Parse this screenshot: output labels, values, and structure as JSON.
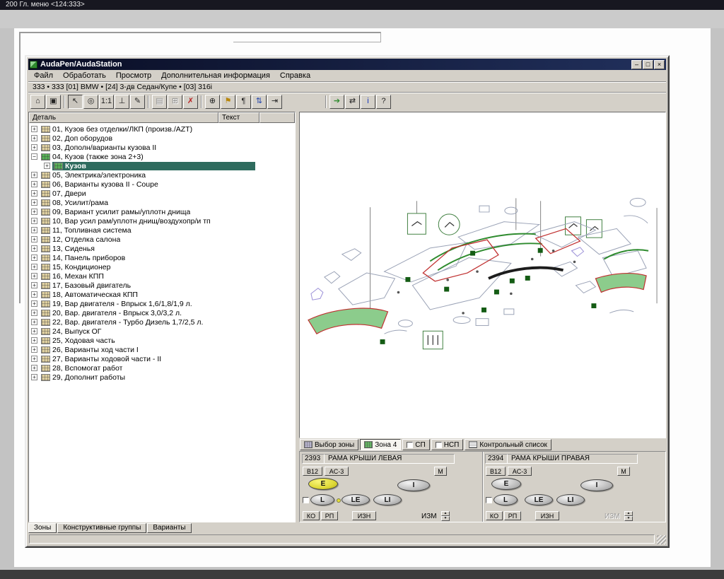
{
  "system": {
    "top_bar_text": "200 Гл. меню  <124:333>"
  },
  "window": {
    "title": "AudaPen/AudaStation",
    "controls": {
      "minimize": "–",
      "maximize": "□",
      "close": "×"
    }
  },
  "menu_bar": {
    "items": [
      "Файл",
      "Обработать",
      "Просмотр",
      "Дополнительная информация",
      "Справка"
    ]
  },
  "path_bar": {
    "text": "333 • 333    [01] BMW  •  [24] 3-дв Седан/Купе  •  [03] 316i"
  },
  "toolbar": {
    "groups": [
      {
        "buttons": [
          {
            "name": "home",
            "glyph": "⌂"
          },
          {
            "name": "workstation",
            "glyph": "▣"
          }
        ]
      },
      {
        "buttons": [
          {
            "name": "select-cursor",
            "glyph": "↖",
            "pressed": true
          },
          {
            "name": "zoom",
            "glyph": "◎"
          },
          {
            "name": "actual-size",
            "glyph": "1:1"
          },
          {
            "name": "measure",
            "glyph": "⊥"
          },
          {
            "name": "draw",
            "glyph": "✎"
          }
        ]
      },
      {
        "buttons": [
          {
            "name": "print",
            "glyph": "▤",
            "disabled": true
          },
          {
            "name": "copy",
            "glyph": "⊞",
            "disabled": true
          },
          {
            "name": "delete",
            "glyph": "✗",
            "color": "#bb2222"
          }
        ]
      },
      {
        "buttons": [
          {
            "name": "zoom-page",
            "glyph": "⊕"
          },
          {
            "name": "flag",
            "glyph": "⚑",
            "color": "#b8860b"
          },
          {
            "name": "pilcrow",
            "glyph": "¶"
          },
          {
            "name": "sort",
            "glyph": "⇅",
            "color": "#2244aa"
          },
          {
            "name": "jump",
            "glyph": "⇥"
          }
        ]
      },
      {
        "gap": true,
        "buttons": [
          {
            "name": "exit",
            "glyph": "➔",
            "color": "#2e8b2e"
          },
          {
            "name": "transfer",
            "glyph": "⇄"
          },
          {
            "name": "info",
            "glyph": "i",
            "color": "#1133bb"
          },
          {
            "name": "help",
            "glyph": "?"
          }
        ]
      }
    ]
  },
  "tree_panel": {
    "columns": [
      {
        "label": "Деталь"
      },
      {
        "label": "Текст"
      }
    ],
    "items": [
      {
        "glyph": "+",
        "icon": "group",
        "label": "01, Кузов без отделки/ЛКП (произв./AZT)"
      },
      {
        "glyph": "+",
        "icon": "group",
        "label": "02, Доп оборудов"
      },
      {
        "glyph": "+",
        "icon": "group",
        "label": "03, Дополн/варианты кузова II"
      },
      {
        "glyph": "−",
        "icon": "zone",
        "label": "04, Кузов (также зона 2+3)"
      },
      {
        "glyph": "+",
        "icon": "zone",
        "label": "Кузов",
        "child": true,
        "selected": true
      },
      {
        "glyph": "+",
        "icon": "group",
        "label": "05, Электрика/электроника"
      },
      {
        "glyph": "+",
        "icon": "group",
        "label": "06, Варианты кузова II - Coupe"
      },
      {
        "glyph": "+",
        "icon": "group",
        "label": "07, Двери"
      },
      {
        "glyph": "+",
        "icon": "group",
        "label": "08, Усилит/рама"
      },
      {
        "glyph": "+",
        "icon": "group",
        "label": "09, Вариант усилит рамы/уплотн днища"
      },
      {
        "glyph": "+",
        "icon": "group",
        "label": "10, Вар усил рам/уплотн днищ/воздухопр/и тп"
      },
      {
        "glyph": "+",
        "icon": "group",
        "label": "11, Топливная система"
      },
      {
        "glyph": "+",
        "icon": "group",
        "label": "12, Отделка салона"
      },
      {
        "glyph": "+",
        "icon": "group",
        "label": "13, Сиденья"
      },
      {
        "glyph": "+",
        "icon": "group",
        "label": "14, Панель приборов"
      },
      {
        "glyph": "+",
        "icon": "group",
        "label": "15, Кондиционер"
      },
      {
        "glyph": "+",
        "icon": "group",
        "label": "16, Механ КПП"
      },
      {
        "glyph": "+",
        "icon": "group",
        "label": "17, Базовый двигатель"
      },
      {
        "glyph": "+",
        "icon": "group",
        "label": "18, Автоматическая КПП"
      },
      {
        "glyph": "+",
        "icon": "group",
        "label": "19, Вар двигателя - Впрыск 1,6/1,8/1,9 л."
      },
      {
        "glyph": "+",
        "icon": "group",
        "label": "20, Вар. двигателя - Впрыск 3,0/3,2 л."
      },
      {
        "glyph": "+",
        "icon": "group",
        "label": "22, Вар. двигателя - Турбо Дизель 1,7/2,5 л."
      },
      {
        "glyph": "+",
        "icon": "group",
        "label": "24, Выпуск ОГ"
      },
      {
        "glyph": "+",
        "icon": "group",
        "label": "25, Ходовая часть"
      },
      {
        "glyph": "+",
        "icon": "group",
        "label": "26, Варианты ход части I"
      },
      {
        "glyph": "+",
        "icon": "group",
        "label": "27, Варианты ходовой части - II"
      },
      {
        "glyph": "+",
        "icon": "group",
        "label": "28, Вспомогат работ"
      },
      {
        "glyph": "+",
        "icon": "group",
        "label": "29, Дополнит работы"
      }
    ]
  },
  "view_tabs": [
    {
      "label": "Выбор зоны",
      "icon": "zone-select",
      "active": false
    },
    {
      "label": "Зона 4",
      "icon": "zone-active",
      "active": true
    },
    {
      "label": "СП",
      "icon": "checkbox",
      "active": false
    },
    {
      "label": "НСП",
      "icon": "checkbox",
      "active": false
    },
    {
      "label": "Контрольный список",
      "icon": "checklist",
      "active": false
    }
  ],
  "parts": [
    {
      "code": "2393",
      "name": "РАМА КРЫШИ ЛЕВАЯ",
      "btn_b": "B12",
      "btn_ac": "AC-3",
      "btn_m": "M",
      "btn_e": "E",
      "btn_i": "I",
      "btn_l": "L",
      "btn_le": "LE",
      "btn_li": "LI",
      "btn_ko": "КО",
      "btn_rp": "РП",
      "btn_izn": "ИЗН",
      "izm": "ИЗМ",
      "e_highlighted": true,
      "le_dot": true,
      "izm_disabled": false
    },
    {
      "code": "2394",
      "name": "РАМА КРЫШИ ПРАВАЯ",
      "btn_b": "B12",
      "btn_ac": "AC-3",
      "btn_m": "M",
      "btn_e": "E",
      "btn_i": "I",
      "btn_l": "L",
      "btn_le": "LE",
      "btn_li": "LI",
      "btn_ko": "КО",
      "btn_rp": "РП",
      "btn_izn": "ИЗН",
      "izm": "ИЗМ",
      "e_highlighted": false,
      "le_dot": false,
      "izm_disabled": true
    }
  ],
  "parts_ui": {
    "spin_up": "▲",
    "spin_down": "▼"
  },
  "bottom_tabs": [
    {
      "label": "Зоны",
      "active": true
    },
    {
      "label": "Конструктивные группы",
      "active": false
    },
    {
      "label": "Варианты",
      "active": false
    }
  ],
  "colors": {
    "selection_teal": "#2e6b5e",
    "zone_green": "#2e8b2e",
    "e_button_yellow": "#e4df3a",
    "highlight_red": "#c03030"
  }
}
